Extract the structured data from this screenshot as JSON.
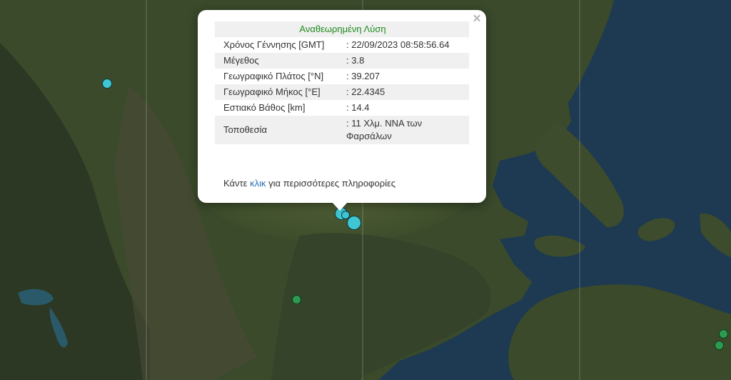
{
  "popup": {
    "title": "Αναθεωρημένη Λύση",
    "close_symbol": "×",
    "rows": [
      {
        "label": "Χρόνος Γέννησης [GMT]",
        "value": ": 22/09/2023 08:58:56.64"
      },
      {
        "label": "Μέγεθος",
        "value": ": 3.8"
      },
      {
        "label": "Γεωγραφικό Πλάτος [°N]",
        "value": ": 39.207"
      },
      {
        "label": "Γεωγραφικό Μήκος [°E]",
        "value": ": 22.4345"
      },
      {
        "label": "Εστιακό Βάθος [km]",
        "value": ": 14.4"
      },
      {
        "label": "Τοποθεσία",
        "value": ": 11 Χλμ. ΝΝΑ των Φαρσάλων"
      }
    ],
    "more_prefix": "Κάντε ",
    "more_link": "κλικ",
    "more_suffix": " για περισσότερες πληροφορίες"
  },
  "colors": {
    "land": "#3b4a2c",
    "sea": "#1d3a52",
    "marker_recent": "#3fc6d2",
    "marker_older": "#2f9a4f",
    "title_green": "#1f8a1f",
    "link_blue": "#2a6fb5"
  },
  "map": {
    "type": "satellite",
    "markers_count": 7
  }
}
